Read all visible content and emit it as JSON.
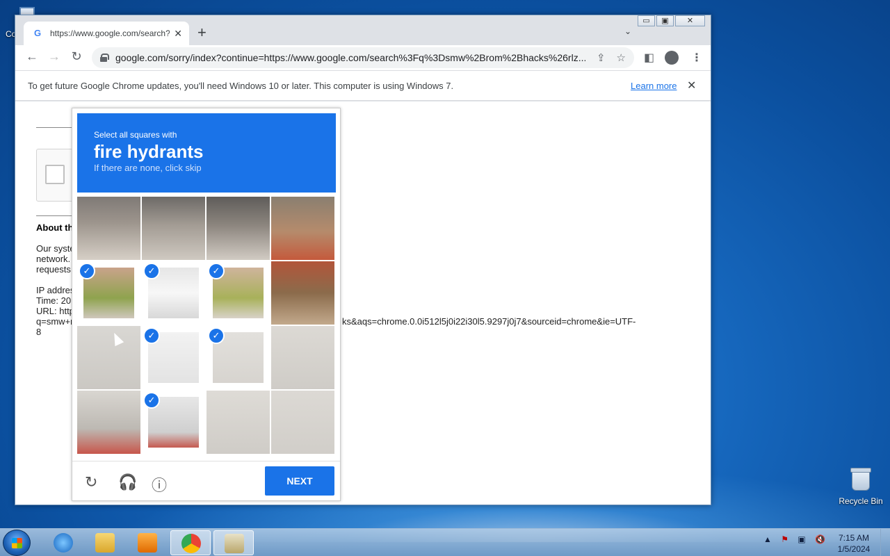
{
  "desktop": {
    "recycle_bin_label": "Recycle Bin",
    "top_left_label": "Co"
  },
  "browser": {
    "tab_title": "https://www.google.com/search?",
    "address": "google.com/sorry/index?continue=https://www.google.com/search%3Fq%3Dsmw%2Brom%2Bhacks%26rlz...",
    "infobar_message": "To get future Google Chrome updates, you'll need Windows 10 or later. This computer is using Windows 7.",
    "infobar_link": "Learn more",
    "window_controls": {
      "minimize": "▭",
      "maximize": "▣",
      "close": "✕"
    }
  },
  "page": {
    "about_heading": "About th",
    "para1": [
      "Our syste",
      "network.",
      "requests"
    ],
    "para2": [
      "IP addres",
      "Time: 20",
      "URL: http",
      "q=smw+r",
      "8"
    ],
    "url_tail": "ks&aqs=chrome.0.0i512l5j0i22i30l5.9297j0j7&sourceid=chrome&ie=UTF-"
  },
  "captcha": {
    "instruction_small": "Select all squares with",
    "instruction_big": "fire hydrants",
    "instruction_note": "If there are none, click skip",
    "next_label": "NEXT",
    "selected_cells": [
      4,
      5,
      6,
      9,
      10,
      13
    ]
  },
  "taskbar": {
    "clock_time": "7:15 AM",
    "clock_date": "1/5/2024"
  }
}
